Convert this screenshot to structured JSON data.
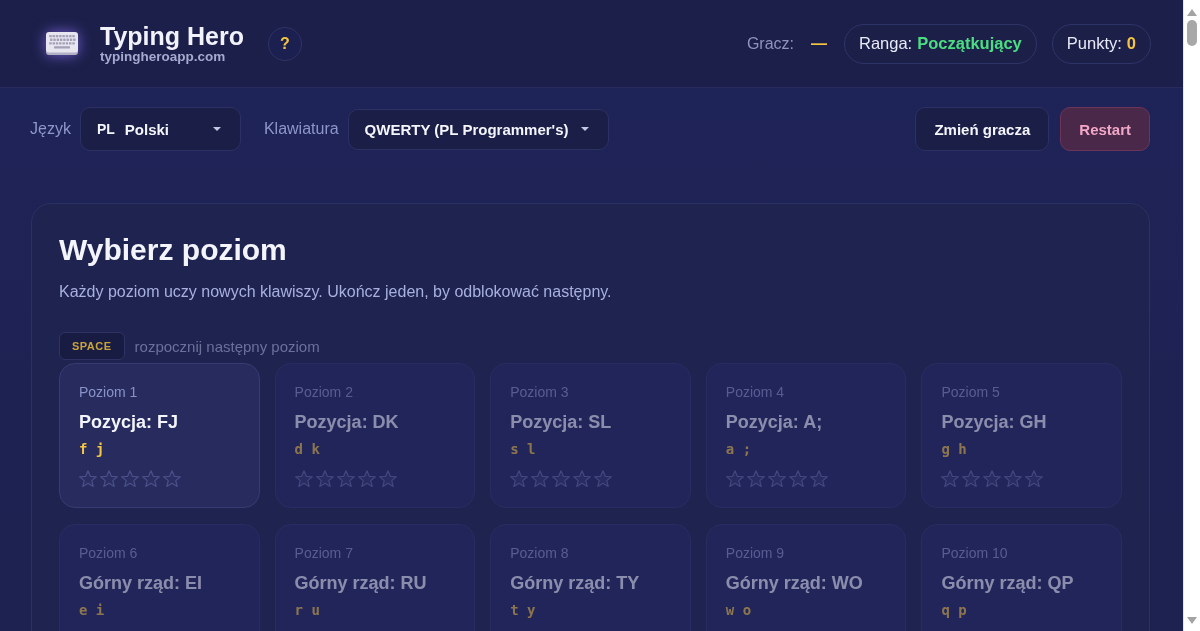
{
  "header": {
    "title": "Typing Hero",
    "subtitle": "typingheroapp.com",
    "help_button": "?",
    "player_label": "Gracz:",
    "player_value": "—",
    "rank_label": "Ranga:",
    "rank_value": "Początkujący",
    "points_label": "Punkty:",
    "points_value": "0"
  },
  "toolbar": {
    "language": {
      "label": "Język",
      "code": "PL",
      "value": "Polski"
    },
    "keyboard": {
      "label": "Klawiatura",
      "value": "QWERTY (PL Programmer's)"
    },
    "buttons": [
      {
        "label": "Zmień gracza",
        "kind": "default"
      },
      {
        "label": "Restart",
        "kind": "danger"
      }
    ]
  },
  "levels_panel": {
    "title": "Wybierz poziom",
    "description": "Każdy poziom uczy nowych klawiszy. Ukończ jeden, by odblokować następny.",
    "hint_key": "SPACE",
    "hint_text": "rozpocznij następny poziom",
    "levels": [
      {
        "label": "Poziom 1",
        "title": "Pozycja: FJ",
        "keys": "f j",
        "locked": false,
        "stars": 0
      },
      {
        "label": "Poziom 2",
        "title": "Pozycja: DK",
        "keys": "d k",
        "locked": true,
        "stars": 0
      },
      {
        "label": "Poziom 3",
        "title": "Pozycja: SL",
        "keys": "s l",
        "locked": true,
        "stars": 0
      },
      {
        "label": "Poziom 4",
        "title": "Pozycja: A;",
        "keys": "a ;",
        "locked": true,
        "stars": 0
      },
      {
        "label": "Poziom 5",
        "title": "Pozycja: GH",
        "keys": "g h",
        "locked": true,
        "stars": 0
      },
      {
        "label": "Poziom 6",
        "title": "Górny rząd: EI",
        "keys": "e i",
        "locked": true
      },
      {
        "label": "Poziom 7",
        "title": "Górny rząd: RU",
        "keys": "r u",
        "locked": true
      },
      {
        "label": "Poziom 8",
        "title": "Górny rząd: TY",
        "keys": "t y",
        "locked": true
      },
      {
        "label": "Poziom 9",
        "title": "Górny rząd: WO",
        "keys": "w o",
        "locked": true
      },
      {
        "label": "Poziom 10",
        "title": "Górny rząd: QP",
        "keys": "q p",
        "locked": true
      }
    ]
  }
}
